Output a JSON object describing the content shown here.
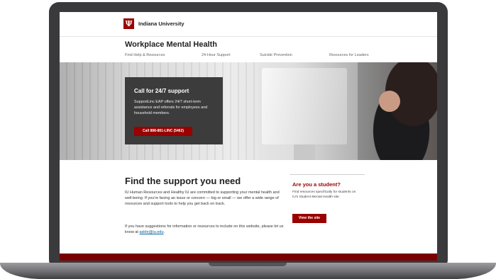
{
  "header": {
    "logo_glyph": "Ψ",
    "university": "Indiana University"
  },
  "site": {
    "title": "Workplace Mental Health"
  },
  "nav": {
    "items": [
      {
        "label": "Find Help & Resources"
      },
      {
        "label": "24-Hour Support"
      },
      {
        "label": "Suicide Prevention"
      },
      {
        "label": "Resources for Leaders"
      }
    ]
  },
  "hero": {
    "callout_title": "Call for 24/7 support",
    "callout_body": "SupportLinc EAP offers 24/7 short-term assistance and referrals for employees and household members.",
    "callout_button": "Call 888-881-LINC (5462)"
  },
  "main": {
    "heading": "Find the support you need",
    "paragraph1": "IU Human Resources and Healthy IU are committed to supporting your mental health and well-being. If you're facing an issue or concern — big or small — we offer a wide range of resources and support tools to help you get back on track.",
    "paragraph2_prefix": "If you have suggestions for information or resources to include on this website, please let us know at ",
    "email": "askhr@iu.edu",
    "paragraph2_suffix": "."
  },
  "student": {
    "title": "Are you a student?",
    "text": "Find resources specifically for students on IU's Student Mental Health site.",
    "button": "View the site"
  },
  "colors": {
    "brand_crimson": "#990000",
    "frame": "#3a3a3c",
    "callout_bg": "#3c3c3c"
  }
}
